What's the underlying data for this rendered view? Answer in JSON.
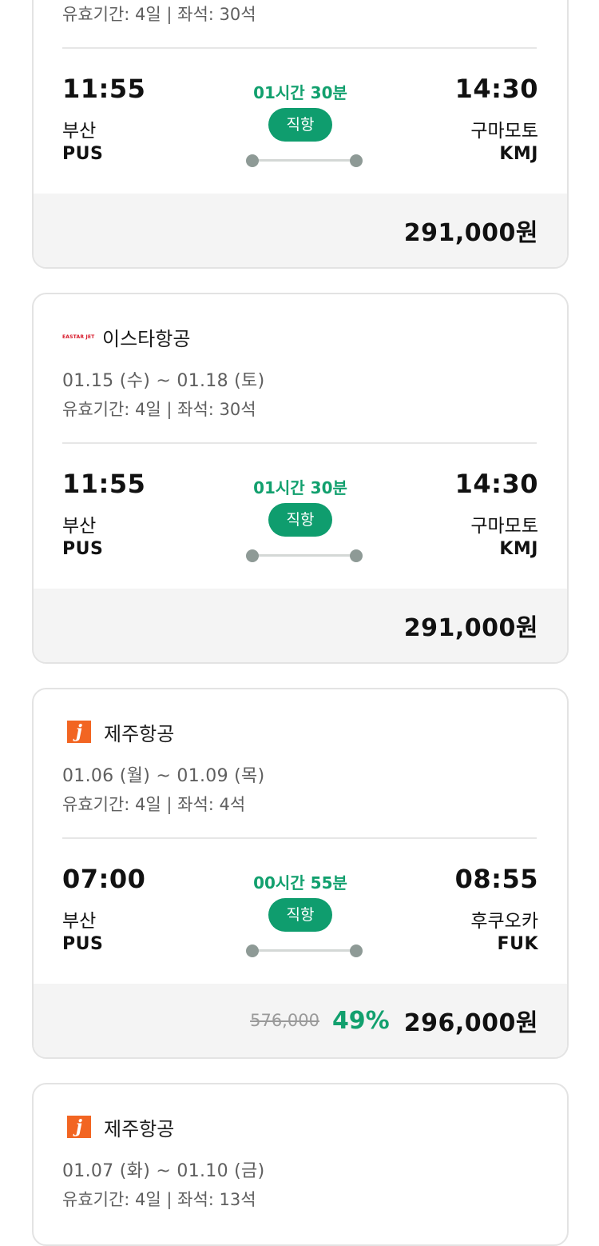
{
  "cards": [
    {
      "validity": "유효기간: 4일 | 좌석: 30석",
      "dep_time": "11:55",
      "dep_city": "부산",
      "dep_code": "PUS",
      "duration": "01시간 30분",
      "badge": "직항",
      "arr_time": "14:30",
      "arr_city": "구마모토",
      "arr_code": "KMJ",
      "price": "291,000원"
    },
    {
      "airline": "이스타항공",
      "logo_text": "EASTAR JET",
      "dates": "01.15 (수) ~ 01.18 (토)",
      "validity": "유효기간: 4일 | 좌석: 30석",
      "dep_time": "11:55",
      "dep_city": "부산",
      "dep_code": "PUS",
      "duration": "01시간 30분",
      "badge": "직항",
      "arr_time": "14:30",
      "arr_city": "구마모토",
      "arr_code": "KMJ",
      "price": "291,000원"
    },
    {
      "airline": "제주항공",
      "logo_text": "j",
      "dates": "01.06 (월) ~ 01.09 (목)",
      "validity": "유효기간: 4일 | 좌석: 4석",
      "dep_time": "07:00",
      "dep_city": "부산",
      "dep_code": "PUS",
      "duration": "00시간 55분",
      "badge": "직항",
      "arr_time": "08:55",
      "arr_city": "후쿠오카",
      "arr_code": "FUK",
      "original_price": "576,000",
      "discount": "49%",
      "price": "296,000원"
    },
    {
      "airline": "제주항공",
      "logo_text": "j",
      "dates": "01.07 (화) ~ 01.10 (금)",
      "validity": "유효기간: 4일 | 좌석: 13석"
    }
  ],
  "colors": {
    "accent_green": "#0f9d6e",
    "eastar_red": "#d7192a",
    "jeju_orange": "#f26522"
  }
}
